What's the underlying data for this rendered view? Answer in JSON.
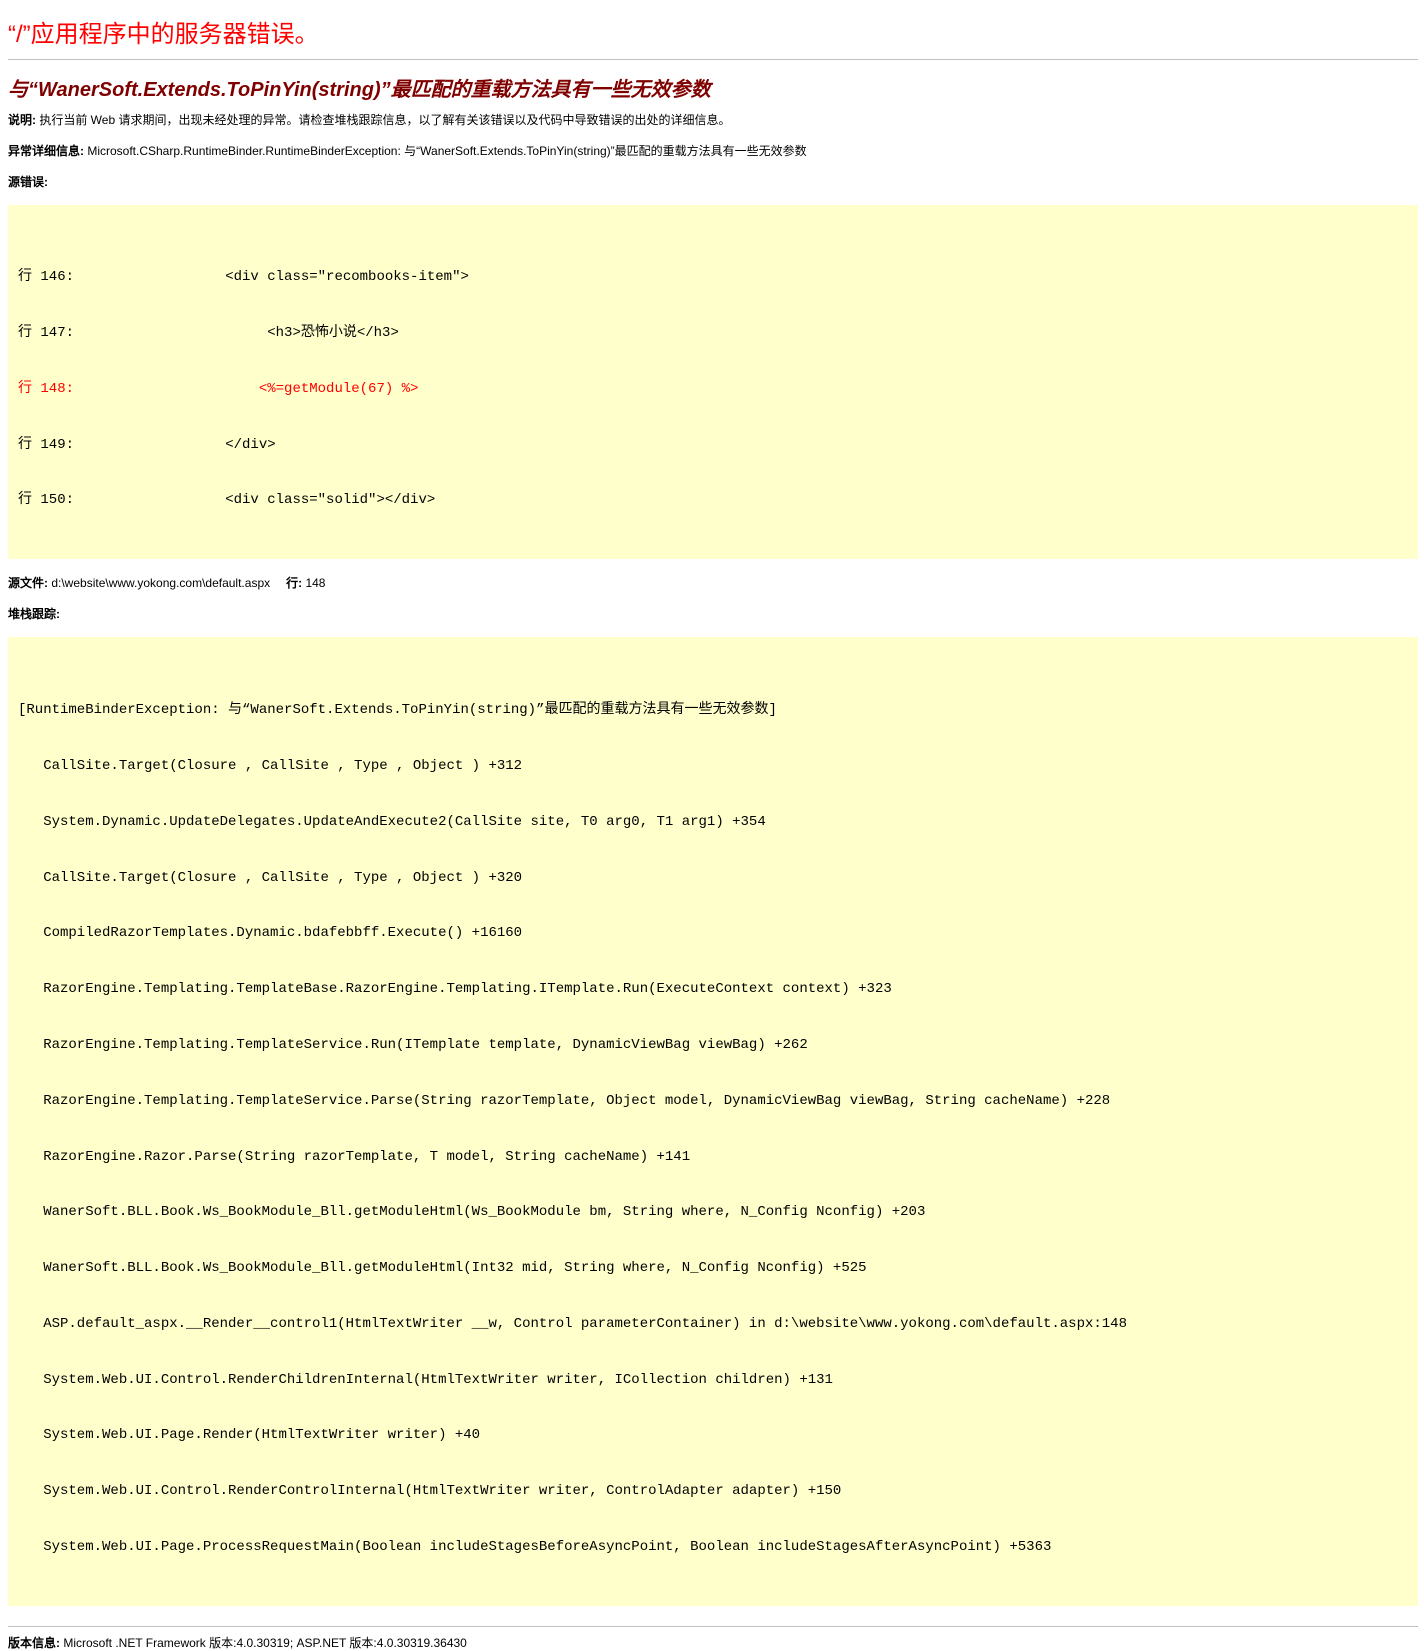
{
  "page": {
    "title": "“/”应用程序中的服务器错误。",
    "error_message": "与“WanerSoft.Extends.ToPinYin(string)”最匹配的重载方法具有一些无效参数"
  },
  "description": {
    "label": "说明:",
    "text": " 执行当前 Web 请求期间，出现未经处理的异常。请检查堆栈跟踪信息，以了解有关该错误以及代码中导致错误的出处的详细信息。"
  },
  "exception": {
    "label": "异常详细信息:",
    "text": " Microsoft.CSharp.RuntimeBinder.RuntimeBinderException: 与“WanerSoft.Extends.ToPinYin(string)”最匹配的重载方法具有一些无效参数"
  },
  "source_error": {
    "label": "源错误:",
    "lines": [
      {
        "text": "行 146:                  <div class=\"recombooks-item\">",
        "error": false
      },
      {
        "text": "行 147:                       <h3>恐怖小说</h3>",
        "error": false
      },
      {
        "text": "行 148:                      <%=getModule(67) %>",
        "error": true
      },
      {
        "text": "行 149:                  </div>",
        "error": false
      },
      {
        "text": "行 150:                  <div class=\"solid\"></div>",
        "error": false
      }
    ]
  },
  "source_file": {
    "label": "源文件:",
    "path": " d:\\website\\www.yokong.com\\default.aspx",
    "line_label": "行:",
    "line_value": " 148"
  },
  "stack_trace": {
    "label": "堆栈跟踪:",
    "lines": [
      "[RuntimeBinderException: 与“WanerSoft.Extends.ToPinYin(string)”最匹配的重载方法具有一些无效参数]",
      "   CallSite.Target(Closure , CallSite , Type , Object ) +312",
      "   System.Dynamic.UpdateDelegates.UpdateAndExecute2(CallSite site, T0 arg0, T1 arg1) +354",
      "   CallSite.Target(Closure , CallSite , Type , Object ) +320",
      "   CompiledRazorTemplates.Dynamic.bdafebbff.Execute() +16160",
      "   RazorEngine.Templating.TemplateBase.RazorEngine.Templating.ITemplate.Run(ExecuteContext context) +323",
      "   RazorEngine.Templating.TemplateService.Run(ITemplate template, DynamicViewBag viewBag) +262",
      "   RazorEngine.Templating.TemplateService.Parse(String razorTemplate, Object model, DynamicViewBag viewBag, String cacheName) +228",
      "   RazorEngine.Razor.Parse(String razorTemplate, T model, String cacheName) +141",
      "   WanerSoft.BLL.Book.Ws_BookModule_Bll.getModuleHtml(Ws_BookModule bm, String where, N_Config Nconfig) +203",
      "   WanerSoft.BLL.Book.Ws_BookModule_Bll.getModuleHtml(Int32 mid, String where, N_Config Nconfig) +525",
      "   ASP.default_aspx.__Render__control1(HtmlTextWriter __w, Control parameterContainer) in d:\\website\\www.yokong.com\\default.aspx:148",
      "   System.Web.UI.Control.RenderChildrenInternal(HtmlTextWriter writer, ICollection children) +131",
      "   System.Web.UI.Page.Render(HtmlTextWriter writer) +40",
      "   System.Web.UI.Control.RenderControlInternal(HtmlTextWriter writer, ControlAdapter adapter) +150",
      "   System.Web.UI.Page.ProcessRequestMain(Boolean includeStagesBeforeAsyncPoint, Boolean includeStagesAfterAsyncPoint) +5363"
    ]
  },
  "version": {
    "label": "版本信息:",
    "text": " Microsoft .NET Framework 版本:4.0.30319; ASP.NET 版本:4.0.30319.36430"
  },
  "colors": {
    "title": "#ff0000",
    "error_message": "#800000",
    "code_background": "#ffffcc",
    "error_line": "#ff0000",
    "divider": "#c0c0c0"
  }
}
